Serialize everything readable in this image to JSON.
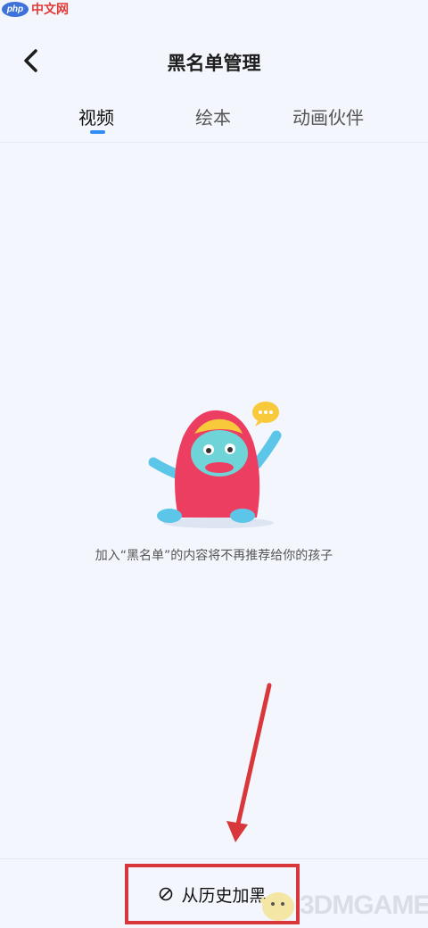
{
  "watermark_top": {
    "logo_text": "php",
    "site_text": "中文网"
  },
  "header": {
    "title": "黑名单管理"
  },
  "tabs": [
    {
      "label": "视频",
      "active": true
    },
    {
      "label": "绘本",
      "active": false
    },
    {
      "label": "动画伙伴",
      "active": false
    }
  ],
  "empty_state": {
    "message": "加入“黑名单”的内容将不再推荐给你的孩子"
  },
  "bottom": {
    "add_label": "从历史加黑"
  },
  "watermark_bottom": {
    "text": "3DMGAME"
  },
  "colors": {
    "accent": "#2f8cf0",
    "highlight": "#d8373c",
    "background": "#f3f6fc"
  }
}
